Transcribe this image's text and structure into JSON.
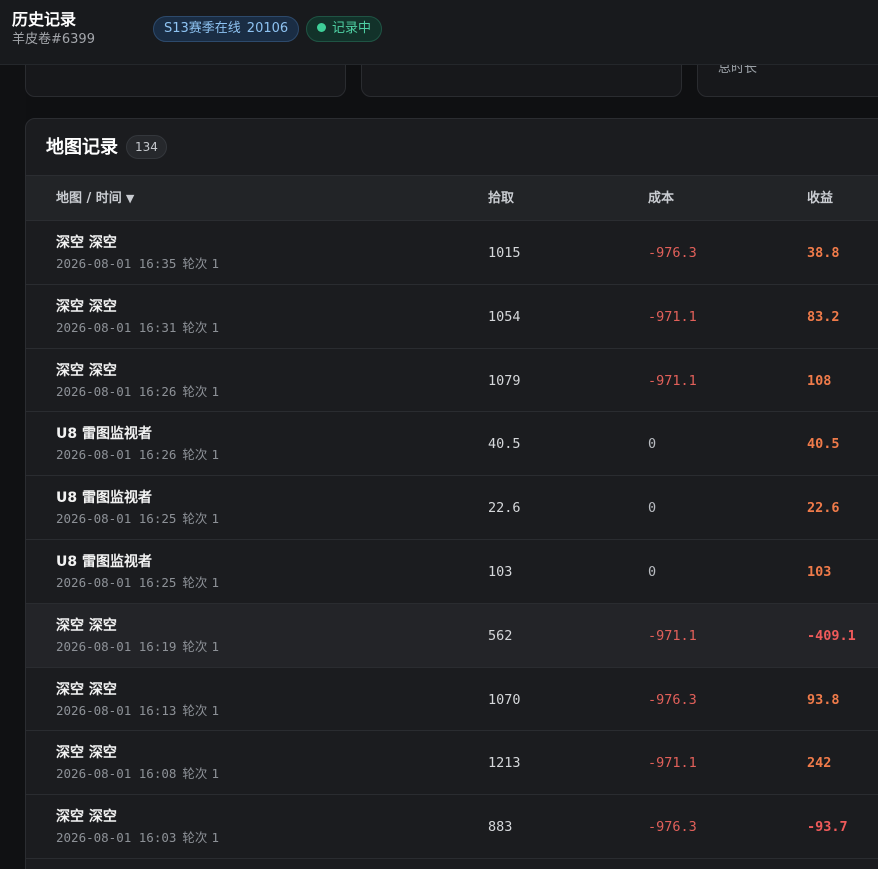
{
  "header": {
    "title": "历史记录",
    "subtitle": "羊皮卷#6399",
    "season_label": "S13赛季在线",
    "season_count": "20106",
    "recording_label": "记录中"
  },
  "stats": {
    "card3_label": "总时长"
  },
  "panel": {
    "title": "地图记录",
    "count": "134",
    "columns": {
      "map_time": "地图 / 时间",
      "pickup": "拾取",
      "cost": "成本",
      "profit": "收益"
    },
    "sort_icon": "sort-desc-triangle",
    "rows": [
      {
        "map": "深空 深空",
        "time": "2026-08-01 16:35",
        "round_label": "轮次",
        "round": "1",
        "pickup": "1015",
        "cost": "-976.3",
        "profit": "38.8"
      },
      {
        "map": "深空 深空",
        "time": "2026-08-01 16:31",
        "round_label": "轮次",
        "round": "1",
        "pickup": "1054",
        "cost": "-971.1",
        "profit": "83.2"
      },
      {
        "map": "深空 深空",
        "time": "2026-08-01 16:26",
        "round_label": "轮次",
        "round": "1",
        "pickup": "1079",
        "cost": "-971.1",
        "profit": "108"
      },
      {
        "map": "U8 雷图监视者",
        "time": "2026-08-01 16:26",
        "round_label": "轮次",
        "round": "1",
        "pickup": "40.5",
        "cost": "0",
        "profit": "40.5"
      },
      {
        "map": "U8 雷图监视者",
        "time": "2026-08-01 16:25",
        "round_label": "轮次",
        "round": "1",
        "pickup": "22.6",
        "cost": "0",
        "profit": "22.6"
      },
      {
        "map": "U8 雷图监视者",
        "time": "2026-08-01 16:25",
        "round_label": "轮次",
        "round": "1",
        "pickup": "103",
        "cost": "0",
        "profit": "103"
      },
      {
        "map": "深空 深空",
        "time": "2026-08-01 16:19",
        "round_label": "轮次",
        "round": "1",
        "pickup": "562",
        "cost": "-971.1",
        "profit": "-409.1"
      },
      {
        "map": "深空 深空",
        "time": "2026-08-01 16:13",
        "round_label": "轮次",
        "round": "1",
        "pickup": "1070",
        "cost": "-976.3",
        "profit": "93.8"
      },
      {
        "map": "深空 深空",
        "time": "2026-08-01 16:08",
        "round_label": "轮次",
        "round": "1",
        "pickup": "1213",
        "cost": "-971.1",
        "profit": "242"
      },
      {
        "map": "深空 深空",
        "time": "2026-08-01 16:03",
        "round_label": "轮次",
        "round": "1",
        "pickup": "883",
        "cost": "-976.3",
        "profit": "-93.7"
      }
    ]
  },
  "colors": {
    "cost_negative": "#e2605a",
    "profit_positive": "#f07b4a",
    "profit_negative": "#ef5a5a",
    "recording_dot": "#3ecf98"
  }
}
